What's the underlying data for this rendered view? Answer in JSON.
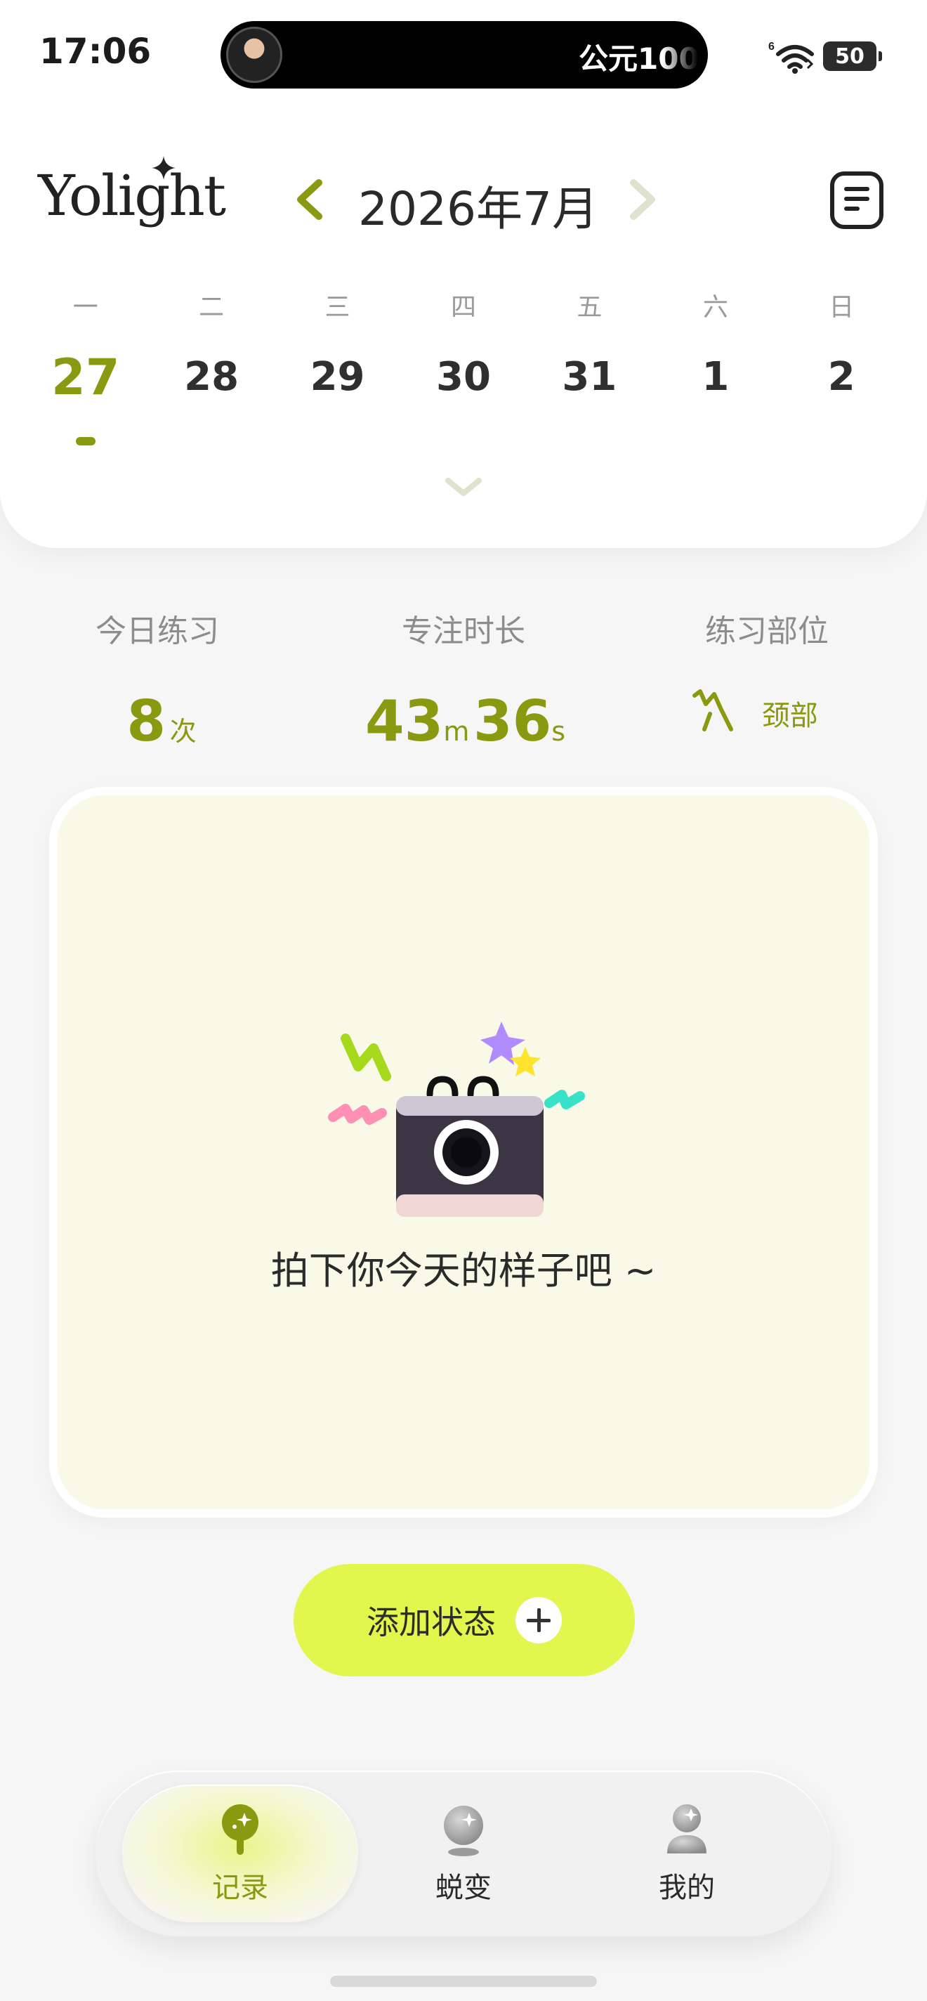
{
  "status_bar": {
    "time": "17:06",
    "live_activity_text": "公元100",
    "battery": "50",
    "signal_label": "6"
  },
  "header": {
    "logo": "Yolight",
    "month": "2026年7月",
    "prev_icon": "chevron-left-icon",
    "next_icon": "chevron-right-icon",
    "menu_icon": "list-icon"
  },
  "calendar": {
    "weekdays": [
      "一",
      "二",
      "三",
      "四",
      "五",
      "六",
      "日"
    ],
    "dates": [
      "27",
      "28",
      "29",
      "30",
      "31",
      "1",
      "2"
    ],
    "selected_index": 0
  },
  "stats": {
    "practice": {
      "label": "今日练习",
      "value": "8",
      "unit": "次"
    },
    "focus": {
      "label": "专注时长",
      "minutes": "43",
      "minutes_unit": "m",
      "seconds": "36",
      "seconds_unit": "s"
    },
    "part": {
      "label": "练习部位",
      "value": "颈部",
      "icon": "neck-pose-icon"
    }
  },
  "photo_card": {
    "prompt": "拍下你今天的样子吧 ~",
    "icon": "camera-illustration"
  },
  "add_button": {
    "label": "添加状态",
    "icon": "plus-icon"
  },
  "tabs": [
    {
      "label": "记录",
      "icon": "record-icon",
      "active": true
    },
    {
      "label": "蜕变",
      "icon": "transform-icon",
      "active": false
    },
    {
      "label": "我的",
      "icon": "profile-icon",
      "active": false
    }
  ],
  "colors": {
    "accent": "#8a9a10",
    "button": "#e2f64e",
    "card": "#f8f9e6"
  }
}
